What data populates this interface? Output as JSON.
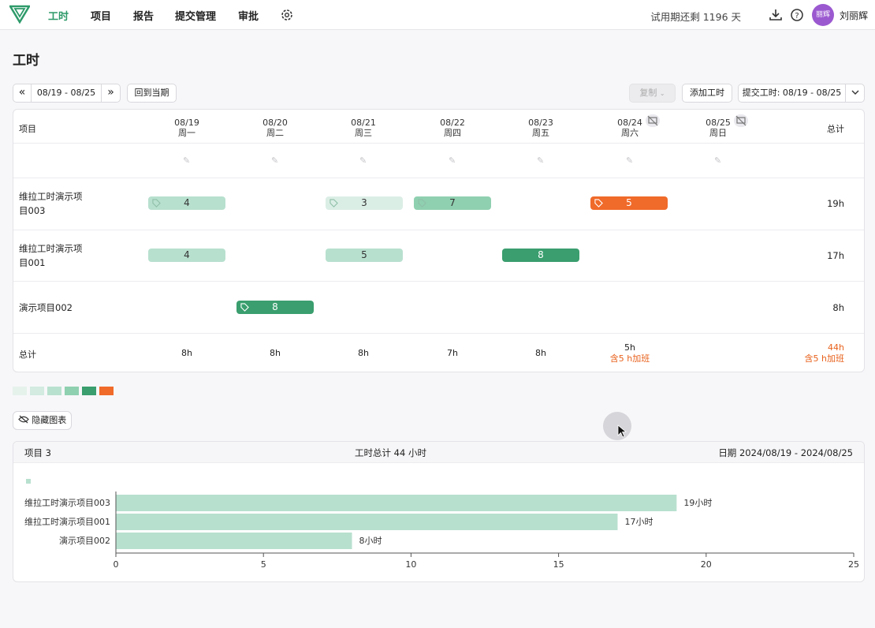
{
  "topbar": {
    "nav": [
      "工时",
      "项目",
      "报告",
      "提交管理",
      "审批"
    ],
    "active_nav": "工时",
    "trial_text": "试用期还剩 1196 天",
    "avatar_text": "丽辉",
    "username": "刘丽辉",
    "icons": [
      "logo-icon",
      "gear-icon",
      "download-icon",
      "help-icon"
    ]
  },
  "page": {
    "title": "工时"
  },
  "toolbar": {
    "prev_label": "«",
    "date_range": "08/19 - 08/25",
    "next_label": "»",
    "back_to_current": "回到当期",
    "copy_label": "复制",
    "add_hours": "添加工时",
    "submit_hours": "提交工时: 08/19 - 08/25"
  },
  "grid": {
    "project_header": "项目",
    "total_header": "总计",
    "days": [
      {
        "date": "08/19",
        "weekday": "周一"
      },
      {
        "date": "08/20",
        "weekday": "周二"
      },
      {
        "date": "08/21",
        "weekday": "周三"
      },
      {
        "date": "08/22",
        "weekday": "周四"
      },
      {
        "date": "08/23",
        "weekday": "周五"
      },
      {
        "date": "08/24",
        "weekday": "周六"
      },
      {
        "date": "08/25",
        "weekday": "周日"
      }
    ],
    "rows": [
      {
        "name_line1": "维拉工时演示项",
        "name_line2": "目003",
        "total": "19h",
        "cells": [
          {
            "day": 0,
            "value": "4",
            "level": 2,
            "tag": true
          },
          {
            "day": 2,
            "value": "3",
            "level": 1,
            "tag": true
          },
          {
            "day": 3,
            "value": "7",
            "level": 3,
            "tag": true
          },
          {
            "day": 5,
            "value": "5",
            "level": 6,
            "tag": true
          }
        ]
      },
      {
        "name_line1": "维拉工时演示项",
        "name_line2": "目001",
        "total": "17h",
        "cells": [
          {
            "day": 0,
            "value": "4",
            "level": 2,
            "tag": false
          },
          {
            "day": 2,
            "value": "5",
            "level": 2,
            "tag": false
          },
          {
            "day": 4,
            "value": "8",
            "level": 5,
            "tag": false
          }
        ]
      },
      {
        "name_line1": "演示项目002",
        "name_line2": "",
        "total": "8h",
        "cells": [
          {
            "day": 1,
            "value": "8",
            "level": 5,
            "tag": true
          }
        ]
      }
    ],
    "footer": {
      "label": "总计",
      "day_totals": [
        "8h",
        "8h",
        "8h",
        "7h",
        "8h",
        "5h",
        ""
      ],
      "day_overtime": [
        "",
        "",
        "",
        "",
        "",
        "含5 h加班",
        ""
      ],
      "grand_total": "44h",
      "grand_overtime": "含5 h加班"
    }
  },
  "colors": {
    "level1": "#dbeee6",
    "level2": "#b8e0cf",
    "level3": "#8fd0b0",
    "level5": "#3a9e6e",
    "level6": "#f06a2a",
    "accent": "#2e9a6a"
  },
  "legend_levels": [
    "#e5f2ec",
    "#d3ebe1",
    "#b9e1cf",
    "#8fd0b0",
    "#3a9e6e",
    "#f06a2a"
  ],
  "hide_chart_label": "隐藏图表",
  "chart_card": {
    "projects_label": "项目 3",
    "total_label": "工时总计 44 小时",
    "date_label": "日期 2024/08/19 - 2024/08/25"
  },
  "chart_data": {
    "type": "bar",
    "orientation": "horizontal",
    "categories": [
      "维拉工时演示项目003",
      "维拉工时演示项目001",
      "演示项目002"
    ],
    "values": [
      19,
      17,
      8
    ],
    "value_labels": [
      "19小时",
      "17小时",
      "8小时"
    ],
    "xlim": [
      0,
      25
    ],
    "xticks": [
      0,
      5,
      10,
      15,
      20,
      25
    ],
    "bar_color": "#b8e0cf"
  }
}
